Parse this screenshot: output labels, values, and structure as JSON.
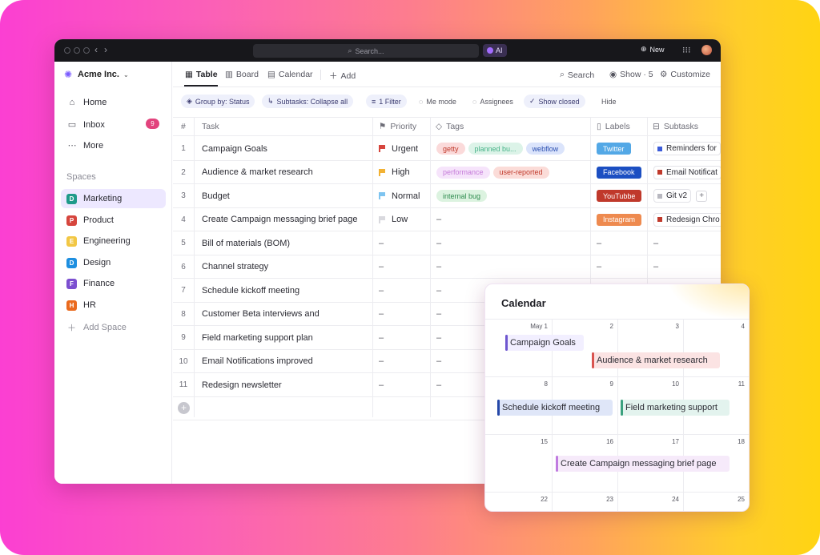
{
  "titlebar": {
    "search_placeholder": "Search...",
    "ai_label": "AI",
    "new_label": "New"
  },
  "sidebar": {
    "workspace_name": "Acme Inc.",
    "nav": [
      {
        "label": "Home",
        "icon": "home-icon"
      },
      {
        "label": "Inbox",
        "icon": "inbox-icon",
        "badge": "9"
      },
      {
        "label": "More",
        "icon": "more-icon"
      }
    ],
    "spaces_heading": "Spaces",
    "spaces": [
      {
        "letter": "D",
        "label": "Marketing",
        "color": "#1f9a8a",
        "active": true
      },
      {
        "letter": "P",
        "label": "Product",
        "color": "#d6453d"
      },
      {
        "letter": "E",
        "label": "Engineering",
        "color": "#f2c744"
      },
      {
        "letter": "D",
        "label": "Design",
        "color": "#1e8fe0"
      },
      {
        "letter": "F",
        "label": "Finance",
        "color": "#7c4fd0"
      },
      {
        "letter": "H",
        "label": "HR",
        "color": "#ea6a1e"
      }
    ],
    "add_space": "Add Space"
  },
  "views": {
    "tabs": [
      "Table",
      "Board",
      "Calendar"
    ],
    "add": "Add",
    "search": "Search",
    "show": "Show · 5",
    "customize": "Customize"
  },
  "filters": {
    "group_by": "Group by: Status",
    "subtasks": "Subtasks: Collapse all",
    "filter": "1 Filter",
    "me_mode": "Me mode",
    "assignees": "Assignees",
    "show_closed": "Show closed",
    "hide": "Hide"
  },
  "table": {
    "columns": [
      "#",
      "Task",
      "Priority",
      "Tags",
      "Labels",
      "Subtasks"
    ],
    "rows": [
      {
        "n": "1",
        "task": "Campaign Goals",
        "priority": "Urgent",
        "priority_color": "#d6453d",
        "tags": [
          {
            "t": "getty",
            "bg": "#fbdada",
            "fg": "#c0392b"
          },
          {
            "t": "planned bu...",
            "bg": "#dcf3e8",
            "fg": "#46b287"
          },
          {
            "t": "webflow",
            "bg": "#dbe4fb",
            "fg": "#2b4fb0"
          }
        ],
        "label": {
          "t": "Twitter",
          "bg": "#53a8e6"
        },
        "subtask": "Reminders for",
        "sub_color": "#3b5bd9"
      },
      {
        "n": "2",
        "task": "Audience & market research",
        "priority": "High",
        "priority_color": "#f2b234",
        "tags": [
          {
            "t": "performance",
            "bg": "#f6e4fb",
            "fg": "#c57bd9"
          },
          {
            "t": "user-reported",
            "bg": "#fbdcd8",
            "fg": "#c0392b"
          }
        ],
        "label": {
          "t": "Facebook",
          "bg": "#1c4fc2"
        },
        "subtask": "Email Notificat",
        "sub_color": "#c0392b"
      },
      {
        "n": "3",
        "task": "Budget",
        "priority": "Normal",
        "priority_color": "#7ec4f0",
        "tags": [
          {
            "t": "internal bug",
            "bg": "#dcf3e0",
            "fg": "#2e8b4e"
          }
        ],
        "label": {
          "t": "YouTubbe",
          "bg": "#c0392b"
        },
        "subtask": "Git v2",
        "sub_color": "#b8b8c0",
        "plus": "+"
      },
      {
        "n": "4",
        "task": "Create Campaign messaging brief page",
        "priority": "Low",
        "priority_color": "#d9d9de",
        "tags": [],
        "tags_dash": "–",
        "label": {
          "t": "Instagram",
          "bg": "#ee8a4f"
        },
        "subtask": "Redesign Chro",
        "sub_color": "#c0392b"
      },
      {
        "n": "5",
        "task": "Bill of materials (BOM)",
        "priority": "–",
        "tags_dash": "–",
        "label_dash": "–",
        "sub_dash": "–"
      },
      {
        "n": "6",
        "task": "Channel strategy",
        "priority": "–",
        "tags_dash": "–",
        "label_dash": "–",
        "sub_dash": "–"
      },
      {
        "n": "7",
        "task": "Schedule kickoff meeting",
        "priority": "–",
        "tags_dash": "–"
      },
      {
        "n": "8",
        "task": "Customer Beta interviews and",
        "priority": "–",
        "tags_dash": "–"
      },
      {
        "n": "9",
        "task": "Field marketing support plan",
        "priority": "–",
        "tags_dash": "–"
      },
      {
        "n": "10",
        "task": "Email Notifications improved",
        "priority": "–",
        "tags_dash": "–"
      },
      {
        "n": "11",
        "task": "Redesign newsletter",
        "priority": "–",
        "tags_dash": "–"
      }
    ]
  },
  "calendar": {
    "title": "Calendar",
    "dates": [
      [
        "May 1",
        "2",
        "3",
        "4"
      ],
      [
        "8",
        "9",
        "10",
        "11"
      ],
      [
        "15",
        "16",
        "17",
        "18"
      ],
      [
        "22",
        "23",
        "24",
        "25"
      ]
    ],
    "events": [
      {
        "label": "Campaign Goals",
        "color": "purple"
      },
      {
        "label": "Audience & market research",
        "color": "red"
      },
      {
        "label": "Schedule kickoff meeting",
        "color": "blue"
      },
      {
        "label": "Field marketing support",
        "color": "green"
      },
      {
        "label": "Create Campaign messaging brief page",
        "color": "violet"
      }
    ]
  }
}
